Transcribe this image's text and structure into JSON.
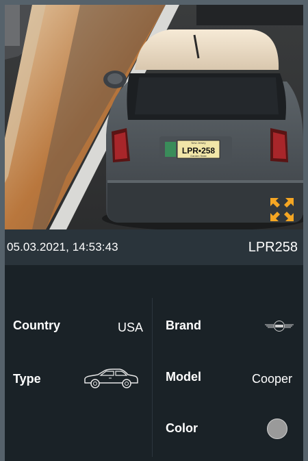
{
  "capture": {
    "timestamp": "05.03.2021, 14:53:43",
    "plate": "LPR258",
    "photo_plate_text": "LPR•258",
    "photo_plate_top": "New Jersey",
    "photo_plate_bottom": "Garden State"
  },
  "details": {
    "country_label": "Country",
    "country_value": "USA",
    "type_label": "Type",
    "type_icon": "sedan-car-icon",
    "brand_label": "Brand",
    "brand_icon": "mini-logo-icon",
    "model_label": "Model",
    "model_value": "Cooper",
    "color_label": "Color",
    "color_value": "#9a9a9a"
  },
  "colors": {
    "accent": "#f5a623",
    "panel": "#1a2227",
    "infobar": "#2a343b"
  }
}
